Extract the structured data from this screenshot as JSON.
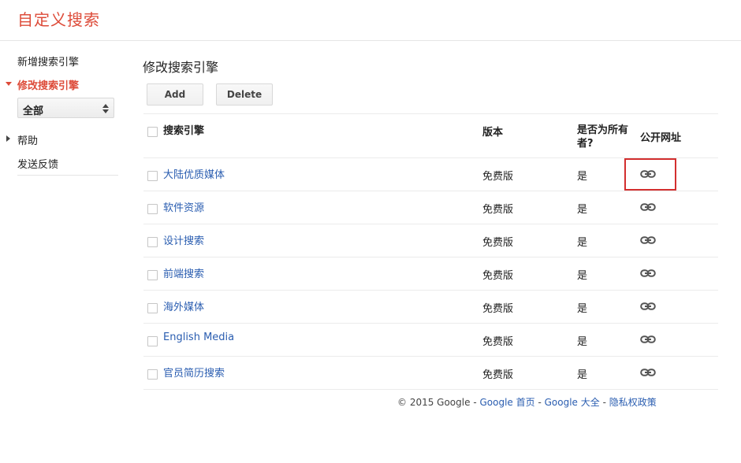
{
  "app": {
    "title": "自定义搜索"
  },
  "sidebar": {
    "items": [
      {
        "label": "新增搜索引擎",
        "active": false
      },
      {
        "label": "修改搜索引擎",
        "active": true
      },
      {
        "label": "帮助",
        "active": false,
        "collapsed": true
      },
      {
        "label": "发送反馈",
        "active": false
      }
    ],
    "select": {
      "value": "全部"
    }
  },
  "main": {
    "title": "修改搜索引擎",
    "buttons": {
      "add": "Add",
      "delete": "Delete"
    },
    "table": {
      "headers": {
        "name": "搜索引擎",
        "version": "版本",
        "owner": "是否为所有者?",
        "public_url": "公开网址"
      },
      "rows": [
        {
          "name": "大陆优质媒体",
          "version": "免费版",
          "owner": "是"
        },
        {
          "name": "软件资源",
          "version": "免费版",
          "owner": "是"
        },
        {
          "name": "设计搜索",
          "version": "免费版",
          "owner": "是"
        },
        {
          "name": "前端搜索",
          "version": "免费版",
          "owner": "是"
        },
        {
          "name": "海外媒体",
          "version": "免费版",
          "owner": "是"
        },
        {
          "name": "English Media",
          "version": "免费版",
          "owner": "是"
        },
        {
          "name": "官员简历搜索",
          "version": "免费版",
          "owner": "是"
        }
      ],
      "link_icon": "link-chain-icon"
    }
  },
  "footer": {
    "copyright": "© 2015 Google",
    "links": [
      "Google 首页",
      "Google 大全",
      "隐私权政策"
    ],
    "separator": "-"
  },
  "colors": {
    "brand": "#dd4b39",
    "link": "#2a5db0",
    "highlight": "#d32f2f"
  }
}
